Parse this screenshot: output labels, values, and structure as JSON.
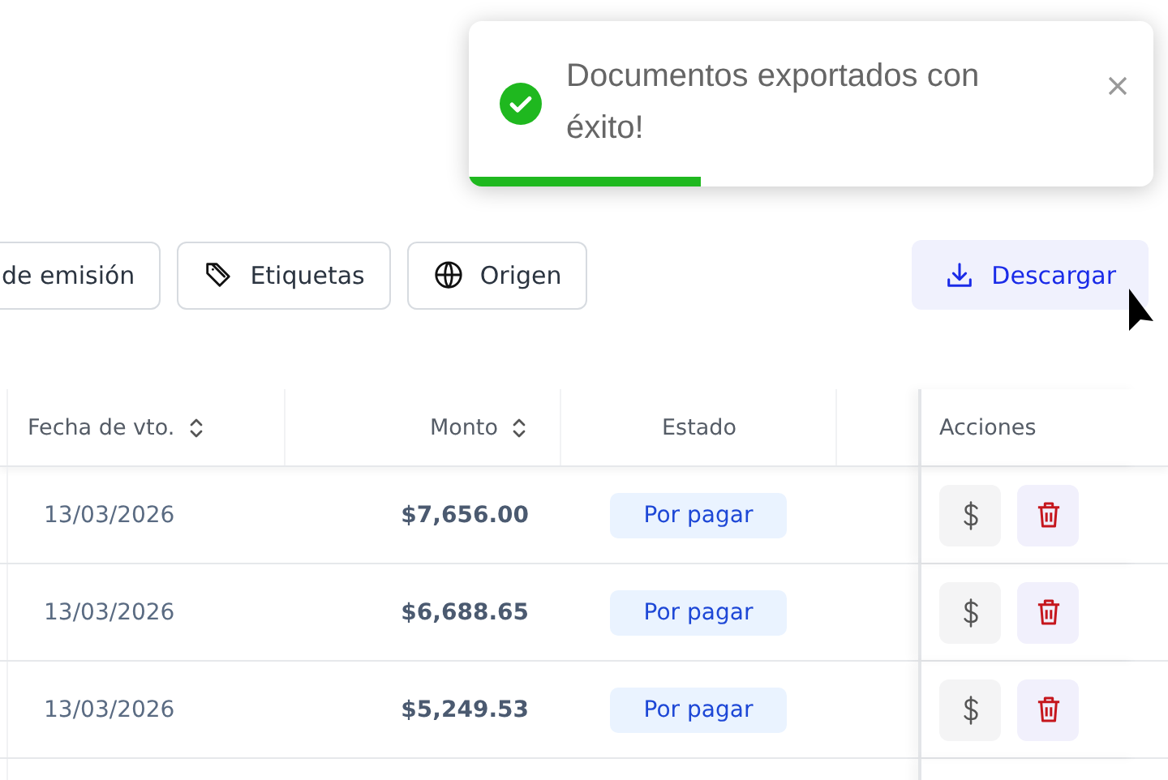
{
  "toast": {
    "message": "Documentos exportados con éxito!",
    "level": 0.34
  },
  "filters": [
    {
      "kind": "plain",
      "label": "de emisión"
    },
    {
      "kind": "tag",
      "label": "Etiquetas"
    },
    {
      "kind": "globe",
      "label": "Origen"
    }
  ],
  "download_button": {
    "label": "Descargar"
  },
  "table": {
    "columns": [
      {
        "label": "Fecha de vto.",
        "sortable": true
      },
      {
        "label": "Monto",
        "sortable": true
      },
      {
        "label": "Estado",
        "sortable": false
      },
      {
        "label": "Acciones",
        "sortable": false
      }
    ],
    "rows": [
      {
        "due": "13/03/2026",
        "amount": "$7,656.00",
        "status": "Por pagar"
      },
      {
        "due": "13/03/2026",
        "amount": "$6,688.65",
        "status": "Por pagar"
      },
      {
        "due": "13/03/2026",
        "amount": "$5,249.53",
        "status": "Por pagar"
      }
    ]
  }
}
